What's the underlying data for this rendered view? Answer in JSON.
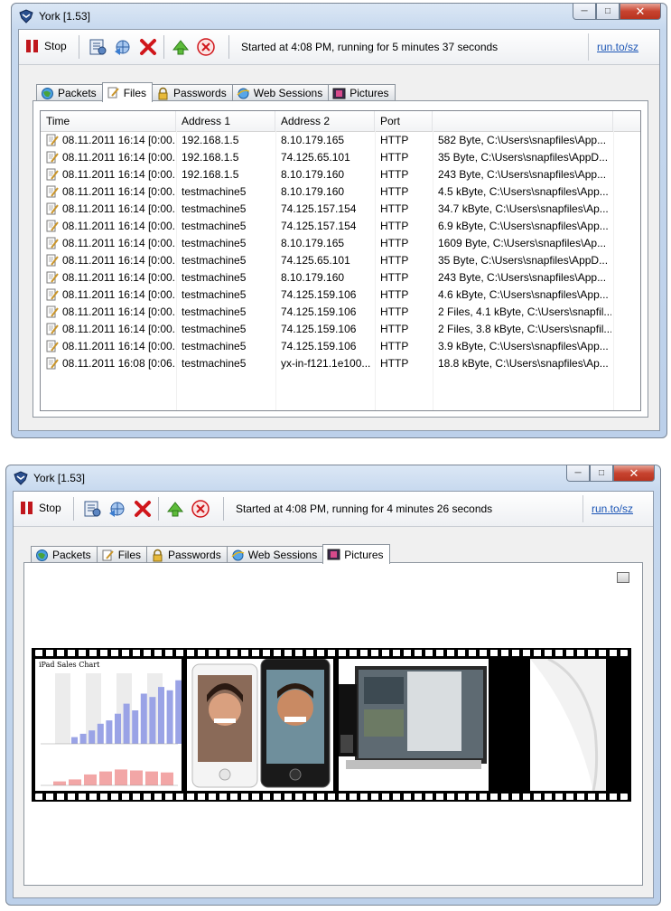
{
  "window_title": "York [1.53]",
  "toolbar": {
    "stop_label": "Stop",
    "link_label": "run.to/sz"
  },
  "window1": {
    "status": "Started at 4:08 PM, running for 5 minutes 37 seconds",
    "active_tab": "Files"
  },
  "window2": {
    "status": "Started at 4:08 PM, running for 4 minutes 26 seconds",
    "active_tab": "Pictures"
  },
  "tabs": [
    "Packets",
    "Files",
    "Passwords",
    "Web Sessions",
    "Pictures"
  ],
  "files_table": {
    "columns": [
      "Time",
      "Address 1",
      "Address 2",
      "Port",
      ""
    ],
    "rows": [
      [
        "08.11.2011 16:14 [0:00...",
        "192.168.1.5",
        "8.10.179.165",
        "HTTP",
        "582 Byte, C:\\Users\\snapfiles\\App..."
      ],
      [
        "08.11.2011 16:14 [0:00...",
        "192.168.1.5",
        "74.125.65.101",
        "HTTP",
        "35 Byte, C:\\Users\\snapfiles\\AppD..."
      ],
      [
        "08.11.2011 16:14 [0:00...",
        "192.168.1.5",
        "8.10.179.160",
        "HTTP",
        "243 Byte, C:\\Users\\snapfiles\\App..."
      ],
      [
        "08.11.2011 16:14 [0:00...",
        "testmachine5",
        "8.10.179.160",
        "HTTP",
        "4.5 kByte, C:\\Users\\snapfiles\\App..."
      ],
      [
        "08.11.2011 16:14 [0:00...",
        "testmachine5",
        "74.125.157.154",
        "HTTP",
        "34.7 kByte, C:\\Users\\snapfiles\\Ap..."
      ],
      [
        "08.11.2011 16:14 [0:00...",
        "testmachine5",
        "74.125.157.154",
        "HTTP",
        "6.9 kByte, C:\\Users\\snapfiles\\App..."
      ],
      [
        "08.11.2011 16:14 [0:00...",
        "testmachine5",
        "8.10.179.165",
        "HTTP",
        "1609 Byte, C:\\Users\\snapfiles\\Ap..."
      ],
      [
        "08.11.2011 16:14 [0:00...",
        "testmachine5",
        "74.125.65.101",
        "HTTP",
        "35 Byte, C:\\Users\\snapfiles\\AppD..."
      ],
      [
        "08.11.2011 16:14 [0:00...",
        "testmachine5",
        "8.10.179.160",
        "HTTP",
        "243 Byte, C:\\Users\\snapfiles\\App..."
      ],
      [
        "08.11.2011 16:14 [0:00...",
        "testmachine5",
        "74.125.159.106",
        "HTTP",
        "4.6 kByte, C:\\Users\\snapfiles\\App..."
      ],
      [
        "08.11.2011 16:14 [0:00...",
        "testmachine5",
        "74.125.159.106",
        "HTTP",
        "2 Files, 4.1 kByte, C:\\Users\\snapfil..."
      ],
      [
        "08.11.2011 16:14 [0:00...",
        "testmachine5",
        "74.125.159.106",
        "HTTP",
        "2 Files, 3.8 kByte, C:\\Users\\snapfil..."
      ],
      [
        "08.11.2011 16:14 [0:00...",
        "testmachine5",
        "74.125.159.106",
        "HTTP",
        "3.9 kByte, C:\\Users\\snapfiles\\App..."
      ],
      [
        "08.11.2011 16:08 [0:06...",
        "testmachine5",
        "yx-in-f121.1e100...",
        "HTTP",
        "18.8 kByte, C:\\Users\\snapfiles\\Ap..."
      ]
    ]
  },
  "pictures": {
    "thumb1_title": "iPad Sales Chart",
    "thumb1_bars": [
      0.1,
      0.15,
      0.2,
      0.3,
      0.35,
      0.45,
      0.6,
      0.5,
      0.75,
      0.7,
      0.85,
      0.8,
      0.95,
      0.9
    ],
    "thumb1_bars2": [
      0.2,
      0.3,
      0.55,
      0.7,
      0.8,
      0.75,
      0.7,
      0.65
    ]
  },
  "colors": {
    "stop": "#c0171d",
    "link": "#1b55b5",
    "close_button": "#c7432f"
  }
}
